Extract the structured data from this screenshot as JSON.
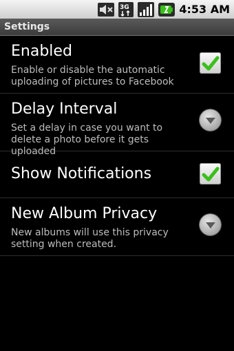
{
  "status_bar": {
    "time": "4:53 AM",
    "icons": [
      "mute-icon",
      "3g-icon",
      "signal-icon",
      "battery-icon"
    ],
    "network_label": "3G"
  },
  "header": {
    "title": "Settings"
  },
  "preferences": [
    {
      "title": "Enabled",
      "summary": "Enable or disable the automatic uploading of pictures to Facebook",
      "widget": "checkbox",
      "checked": true
    },
    {
      "title": "Delay Interval",
      "summary": "Set a delay in case you want to delete a photo before it gets uploaded",
      "widget": "dropdown"
    },
    {
      "title": "Show Notifications",
      "summary": "",
      "widget": "checkbox",
      "checked": true
    },
    {
      "title": "New Album Privacy",
      "summary": "New albums will use this privacy setting when created.",
      "widget": "dropdown"
    }
  ],
  "colors": {
    "check_green": "#3bbf1c",
    "background": "#000000",
    "summary_text": "#bdbdbd"
  }
}
